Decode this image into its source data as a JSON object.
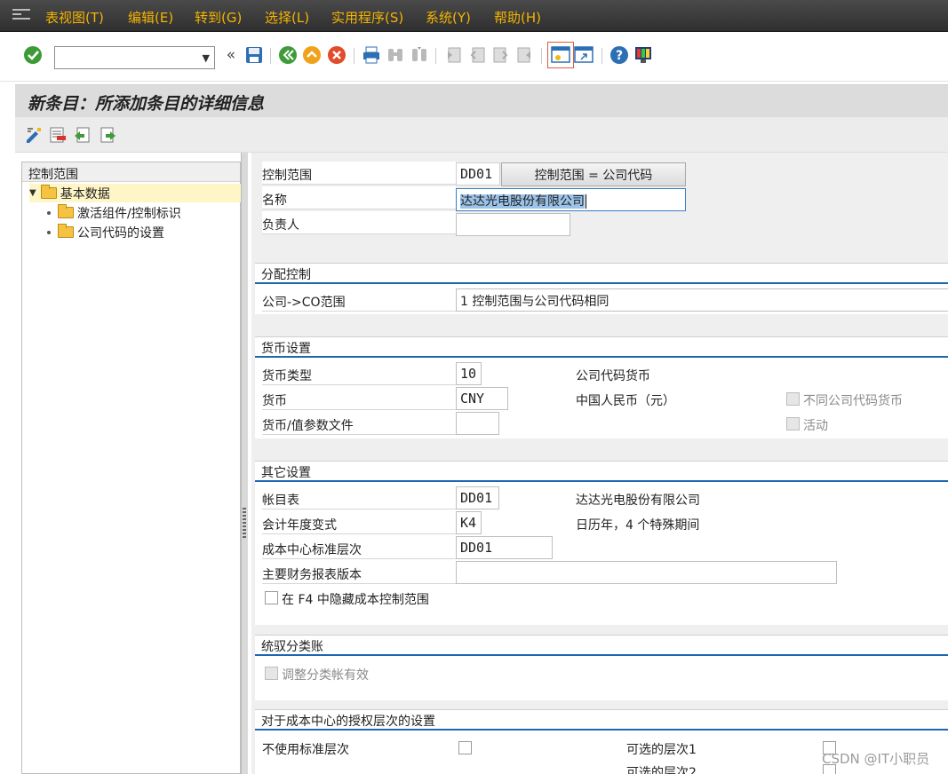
{
  "menu": {
    "items": [
      "表视图(T)",
      "编辑(E)",
      "转到(G)",
      "选择(L)",
      "实用程序(S)",
      "系统(Y)",
      "帮助(H)"
    ]
  },
  "toolbar": {
    "command_field_value": "",
    "icons": [
      "check-icon",
      "back-double-chevron-icon",
      "save-icon",
      "back-icon",
      "exit-icon",
      "cancel-icon",
      "print-icon",
      "find-icon",
      "find-next-icon",
      "first-page-icon",
      "previous-page-icon",
      "next-page-icon",
      "last-page-icon",
      "create-session-icon",
      "generate-shortcut-icon",
      "help-icon",
      "layout-menu-icon"
    ]
  },
  "title": "新条目：所添加条目的详细信息",
  "tree": {
    "header": "控制范围",
    "nodes": [
      {
        "label": "基本数据",
        "level": 0,
        "selected": true,
        "expanded": true
      },
      {
        "label": "激活组件/控制标识",
        "level": 1
      },
      {
        "label": "公司代码的设置",
        "level": 1
      }
    ]
  },
  "header_fields": {
    "controlling_area_label": "控制范围",
    "controlling_area_value": "DD01",
    "controlling_area_button": "控制范围 = 公司代码",
    "name_label": "名称",
    "name_value": "达达光电股份有限公司",
    "person_label": "负责人",
    "person_value": ""
  },
  "assignment": {
    "title": "分配控制",
    "company_co_label": "公司->CO范围",
    "company_co_value": "1 控制范围与公司代码相同"
  },
  "currency": {
    "title": "货币设置",
    "type_label": "货币类型",
    "type_value": "10",
    "type_desc": "公司代码货币",
    "currency_label": "货币",
    "currency_value": "CNY",
    "currency_desc": "中国人民币（元）",
    "diff_cc_label": "不同公司代码货币",
    "active_label": "活动",
    "profile_label": "货币/值参数文件",
    "profile_value": ""
  },
  "other": {
    "title": "其它设置",
    "coa_label": "帐目表",
    "coa_value": "DD01",
    "coa_desc": "达达光电股份有限公司",
    "fy_label": "会计年度变式",
    "fy_value": "K4",
    "fy_desc": "日历年，4 个特殊期间",
    "hier_label": "成本中心标准层次",
    "hier_value": "DD01",
    "report_label": "主要财务报表版本",
    "report_value": "",
    "hide_f4_label": "在 F4 中隐藏成本控制范围"
  },
  "ledger": {
    "title": "统驭分类账",
    "reconcile_label": "调整分类帐有效"
  },
  "auth": {
    "title": "对于成本中心的授权层次的设置",
    "no_std_label": "不使用标准层次",
    "alt1_label": "可选的层次1",
    "alt2_label": "可选的层次2"
  },
  "watermark": "CSDN @IT小职员",
  "colors": {
    "menu_text": "#f4b400",
    "section_line": "#1f66b0",
    "selected_node": "#fff6c7"
  }
}
